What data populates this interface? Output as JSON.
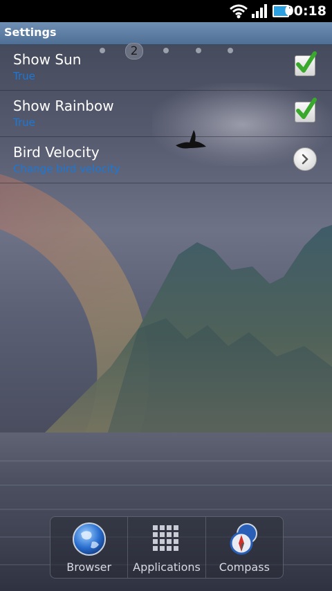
{
  "status_bar": {
    "time": "00:18",
    "icons": [
      "wifi-icon",
      "signal-icon",
      "battery-icon"
    ]
  },
  "header": {
    "title": "Settings"
  },
  "page_indicator": {
    "current": "2",
    "total_dots": 5
  },
  "settings": [
    {
      "title": "Show Sun",
      "summary": "True",
      "control": "checkbox",
      "checked": true
    },
    {
      "title": "Show Rainbow",
      "summary": "True",
      "control": "checkbox",
      "checked": true
    },
    {
      "title": "Bird Velocity",
      "summary": "Change bird velocity",
      "control": "chevron"
    }
  ],
  "dock": {
    "items": [
      {
        "label": "Browser",
        "icon": "globe-icon"
      },
      {
        "label": "Applications",
        "icon": "app-grid-icon"
      },
      {
        "label": "Compass",
        "icon": "compass-icon"
      }
    ]
  },
  "colors": {
    "header_bg": "#5a7aa0",
    "summary_text": "#1978d8",
    "check_green": "#3aa82c"
  }
}
